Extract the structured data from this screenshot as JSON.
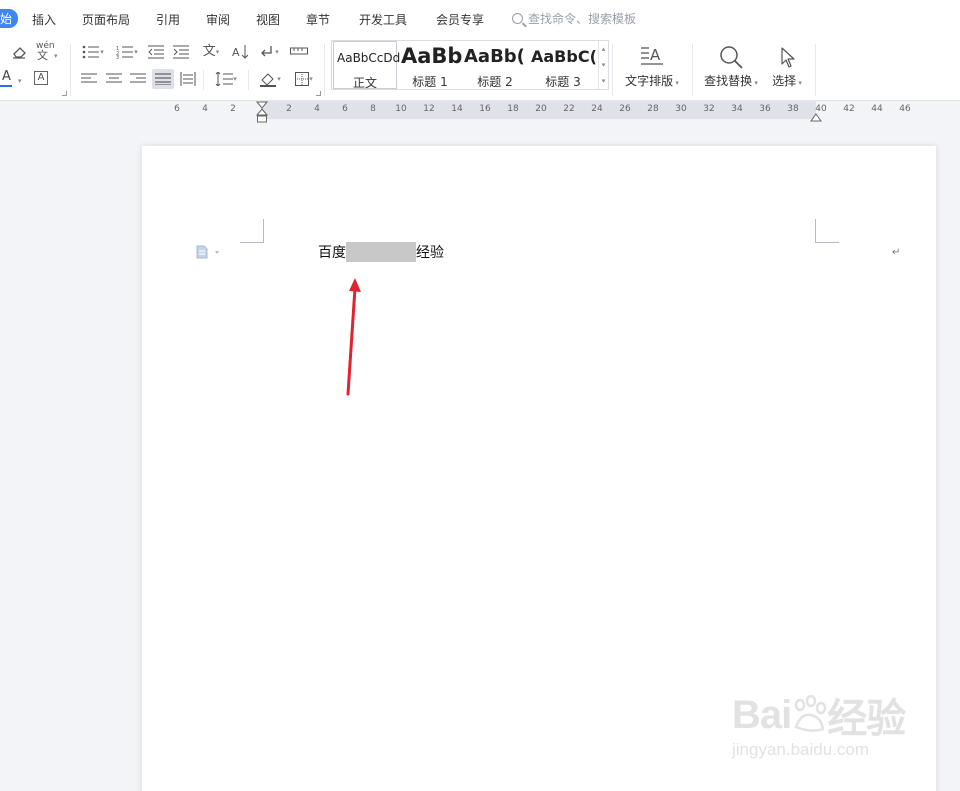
{
  "menu": {
    "active_tab": "始",
    "tabs": [
      "插入",
      "页面布局",
      "引用",
      "审阅",
      "视图",
      "章节",
      "开发工具",
      "会员专享"
    ],
    "search_placeholder": "查找命令、搜索模板"
  },
  "ribbon": {
    "styles": [
      {
        "sample": "AaBbCcDd",
        "label": "正文"
      },
      {
        "sample": "AaBb",
        "label": "标题 1"
      },
      {
        "sample": "AaBb(",
        "label": "标题 2"
      },
      {
        "sample": "AaBbC(",
        "label": "标题 3"
      }
    ],
    "text_layout_label": "文字排版",
    "find_replace_label": "查找替换",
    "select_label": "选择",
    "phonetic_glyph": "wén",
    "underline_color": "#2b6ee8"
  },
  "ruler": {
    "left_ticks": [
      "6",
      "4",
      "2"
    ],
    "right_ticks": [
      "2",
      "4",
      "6",
      "8",
      "10",
      "12",
      "14",
      "16",
      "18",
      "20",
      "22",
      "24",
      "26",
      "28",
      "30",
      "32",
      "34",
      "36",
      "38",
      "40",
      "42",
      "44",
      "46"
    ]
  },
  "document": {
    "text_before": "百度",
    "text_after": "经验",
    "paragraph_mark": "↵"
  },
  "annotation": {
    "arrow_color": "#e0242f"
  },
  "watermark": {
    "logo": "Bai du 经验",
    "url": "jingyan.baidu.com"
  }
}
